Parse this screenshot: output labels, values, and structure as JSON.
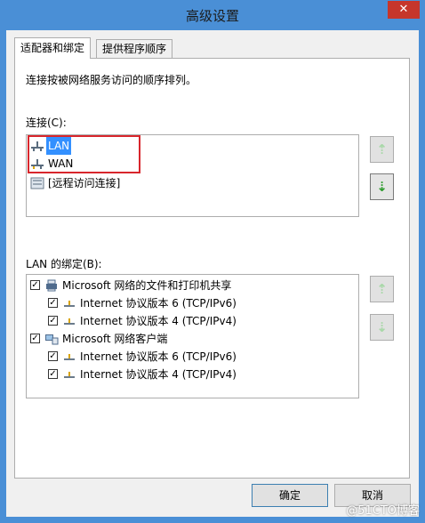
{
  "window": {
    "title": "高级设置",
    "close_glyph": "✕"
  },
  "tabs": [
    {
      "label": "适配器和绑定",
      "active": true
    },
    {
      "label": "提供程序顺序",
      "active": false
    }
  ],
  "description": "连接按被网络服务访问的顺序排列。",
  "connections": {
    "label": "连接(C):",
    "items": [
      {
        "label": "LAN",
        "icon": "network-adapter-icon",
        "selected": true
      },
      {
        "label": "WAN",
        "icon": "network-adapter-icon",
        "selected": false
      },
      {
        "label": "[远程访问连接]",
        "icon": "remote-access-icon",
        "selected": false
      }
    ]
  },
  "bindings": {
    "label": "LAN 的绑定(B):",
    "items": [
      {
        "label": "Microsoft 网络的文件和打印机共享",
        "checked": true,
        "level": 0,
        "icon": "printer-share-icon"
      },
      {
        "label": "Internet 协议版本 6 (TCP/IPv6)",
        "checked": true,
        "level": 1,
        "icon": "protocol-icon"
      },
      {
        "label": "Internet 协议版本 4 (TCP/IPv4)",
        "checked": true,
        "level": 1,
        "icon": "protocol-icon"
      },
      {
        "label": "Microsoft 网络客户端",
        "checked": true,
        "level": 0,
        "icon": "network-client-icon"
      },
      {
        "label": "Internet 协议版本 6 (TCP/IPv6)",
        "checked": true,
        "level": 1,
        "icon": "protocol-icon"
      },
      {
        "label": "Internet 协议版本 4 (TCP/IPv4)",
        "checked": true,
        "level": 1,
        "icon": "protocol-icon"
      }
    ]
  },
  "arrows": {
    "up": "⇡",
    "down": "⇣"
  },
  "buttons": {
    "ok": "确定",
    "cancel": "取消"
  },
  "watermark": "@51CTO博客",
  "colors": {
    "selection": "#3390ff",
    "annotation_box": "#d8262c",
    "arrow_green": "#2e9b2e"
  }
}
